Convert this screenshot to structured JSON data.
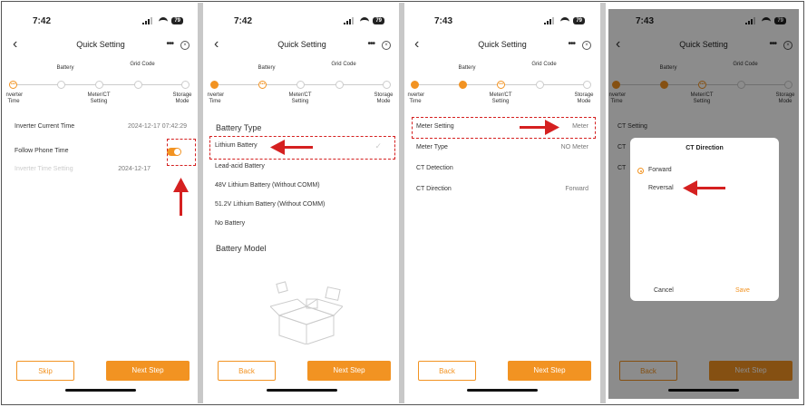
{
  "phones": [
    {
      "time": "7:42",
      "battery": "79",
      "title": "Quick Setting",
      "steps_top": [
        "Battery",
        "Grid Code"
      ],
      "steps_bottom": [
        "Inverter Time",
        "Meter/CT Setting",
        "Storage Mode"
      ],
      "rows": [
        {
          "label": "Inverter Current Time",
          "value": "2024-12-17 07:42:29"
        },
        {
          "label": "Follow Phone Time",
          "value": ""
        },
        {
          "label": "Inverter Time Setting",
          "value": "2024-12-17"
        }
      ],
      "buttons": {
        "left": "Skip",
        "right": "Next Step"
      }
    },
    {
      "time": "7:42",
      "battery": "79",
      "title": "Quick Setting",
      "steps_top": [
        "Battery",
        "Grid Code"
      ],
      "steps_bottom": [
        "Inverter Time",
        "Meter/CT Setting",
        "Storage Mode"
      ],
      "section1": "Battery Type",
      "options": [
        "Lithium Battery",
        "Lead-acid Battery",
        "48V Lithium Battery (Without COMM)",
        "51.2V Lithium Battery (Without COMM)",
        "No Battery"
      ],
      "section2": "Battery Model",
      "buttons": {
        "left": "Back",
        "right": "Next Step"
      }
    },
    {
      "time": "7:43",
      "battery": "79",
      "title": "Quick Setting",
      "steps_top": [
        "Battery",
        "Grid Code"
      ],
      "steps_bottom": [
        "Inverter Time",
        "Meter/CT Setting",
        "Storage Mode"
      ],
      "rows": [
        {
          "label": "Meter Setting",
          "value": "Meter"
        },
        {
          "label": "Meter Type",
          "value": "NO Meter"
        },
        {
          "label": "CT Detection",
          "value": ""
        },
        {
          "label": "CT Direction",
          "value": "Forward"
        }
      ],
      "buttons": {
        "left": "Back",
        "right": "Next Step"
      }
    },
    {
      "time": "7:43",
      "battery": "79",
      "title": "Quick Setting",
      "steps_top": [
        "Battery",
        "Grid Code"
      ],
      "steps_bottom": [
        "Inverter Time",
        "Meter/CT Setting",
        "Storage Mode"
      ],
      "rows": [
        {
          "label": "CT Setting",
          "value": ""
        },
        {
          "label": "CT",
          "value": ""
        },
        {
          "label": "CT",
          "value": ""
        }
      ],
      "dialog": {
        "title": "CT Direction",
        "options": [
          "Forward",
          "Reversal"
        ],
        "cancel": "Cancel",
        "save": "Save"
      },
      "buttons": {
        "left": "Back",
        "right": "Next Step"
      }
    }
  ],
  "colors": {
    "accent": "#f29322",
    "highlight": "#d52020"
  }
}
